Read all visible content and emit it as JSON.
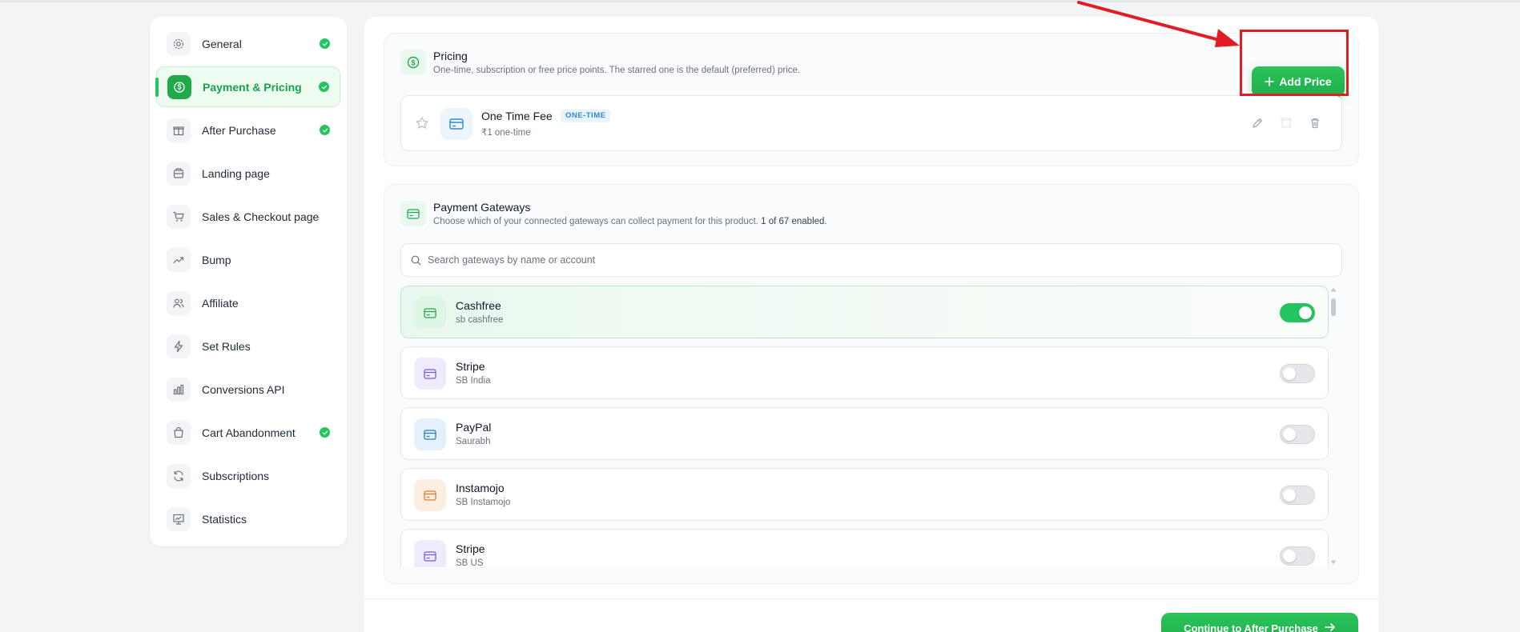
{
  "sidebar": {
    "items": [
      {
        "label": "General",
        "icon": "gear-icon",
        "done": true,
        "active": false
      },
      {
        "label": "Payment & Pricing",
        "icon": "dollar-icon",
        "done": true,
        "active": true
      },
      {
        "label": "After Purchase",
        "icon": "gift-icon",
        "done": true,
        "active": false
      },
      {
        "label": "Landing page",
        "icon": "layout-icon",
        "done": false,
        "active": false
      },
      {
        "label": "Sales & Checkout page",
        "icon": "cart-icon",
        "done": false,
        "active": false
      },
      {
        "label": "Bump",
        "icon": "trending-up-icon",
        "done": false,
        "active": false
      },
      {
        "label": "Affiliate",
        "icon": "users-icon",
        "done": false,
        "active": false
      },
      {
        "label": "Set Rules",
        "icon": "bolt-icon",
        "done": false,
        "active": false
      },
      {
        "label": "Conversions API",
        "icon": "bar-chart-icon",
        "done": false,
        "active": false
      },
      {
        "label": "Cart Abandonment",
        "icon": "shopping-bag-icon",
        "done": true,
        "active": false
      },
      {
        "label": "Subscriptions",
        "icon": "refresh-icon",
        "done": false,
        "active": false
      },
      {
        "label": "Statistics",
        "icon": "presentation-chart-icon",
        "done": false,
        "active": false
      }
    ]
  },
  "pricing": {
    "title": "Pricing",
    "subtitle": "One-time, subscription or free price points. The starred one is the default (preferred) price.",
    "add_button": "Add Price",
    "prices": [
      {
        "name": "One Time Fee",
        "badge": "ONE-TIME",
        "detail": "₹1 one-time"
      }
    ]
  },
  "gateways": {
    "title": "Payment Gateways",
    "subtitle": "Choose which of your connected gateways can collect payment for this product.",
    "count_text": "1 of 67 enabled.",
    "search_placeholder": "Search gateways by name or account",
    "items": [
      {
        "name": "Cashfree",
        "account": "sb cashfree",
        "enabled": true,
        "color": "#22a94a",
        "bg": "#dff5e6"
      },
      {
        "name": "Stripe",
        "account": "SB India",
        "enabled": false,
        "color": "#7c5cd6",
        "bg": "#efeafc"
      },
      {
        "name": "PayPal",
        "account": "Saurabh",
        "enabled": false,
        "color": "#2b7bbf",
        "bg": "#e4f0fb"
      },
      {
        "name": "Instamojo",
        "account": "SB Instamojo",
        "enabled": false,
        "color": "#e07a2a",
        "bg": "#fdeee2"
      },
      {
        "name": "Stripe",
        "account": "SB US",
        "enabled": false,
        "color": "#7c5cd6",
        "bg": "#efeafc"
      }
    ]
  },
  "footer": {
    "continue_label": "Continue to After Purchase"
  },
  "colors": {
    "accent": "#22c55e",
    "annotation": "#e11d24"
  }
}
